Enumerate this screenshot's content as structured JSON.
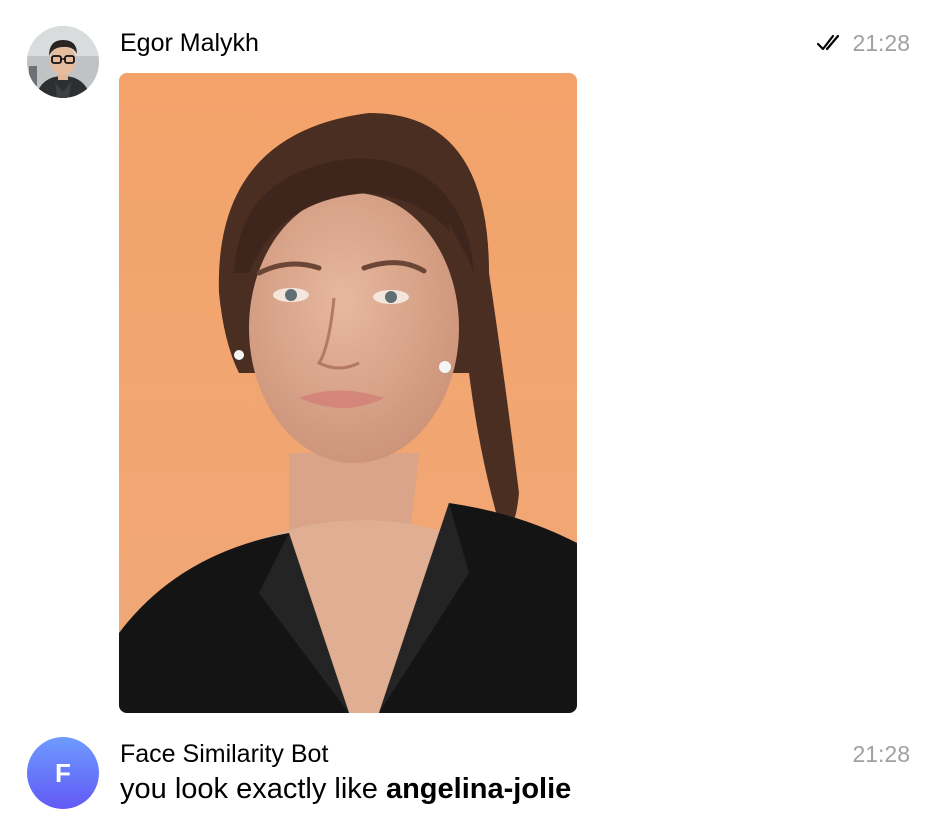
{
  "messages": [
    {
      "sender": "Egor Malykh",
      "time": "21:28",
      "status_icon": "double-check-icon",
      "avatar_icon": "user-photo-avatar",
      "attachment_icon": "photo-attachment"
    },
    {
      "sender": "Face Similarity Bot",
      "time": "21:28",
      "avatar_letter": "F",
      "avatar_gradient": [
        "#6e9bff",
        "#6259f5"
      ],
      "text_prefix": "you look exactly like ",
      "text_bold": "angelina-jolie"
    }
  ],
  "colors": {
    "timestamp": "#a0a0a5",
    "photo_background": "#f2a56d"
  }
}
